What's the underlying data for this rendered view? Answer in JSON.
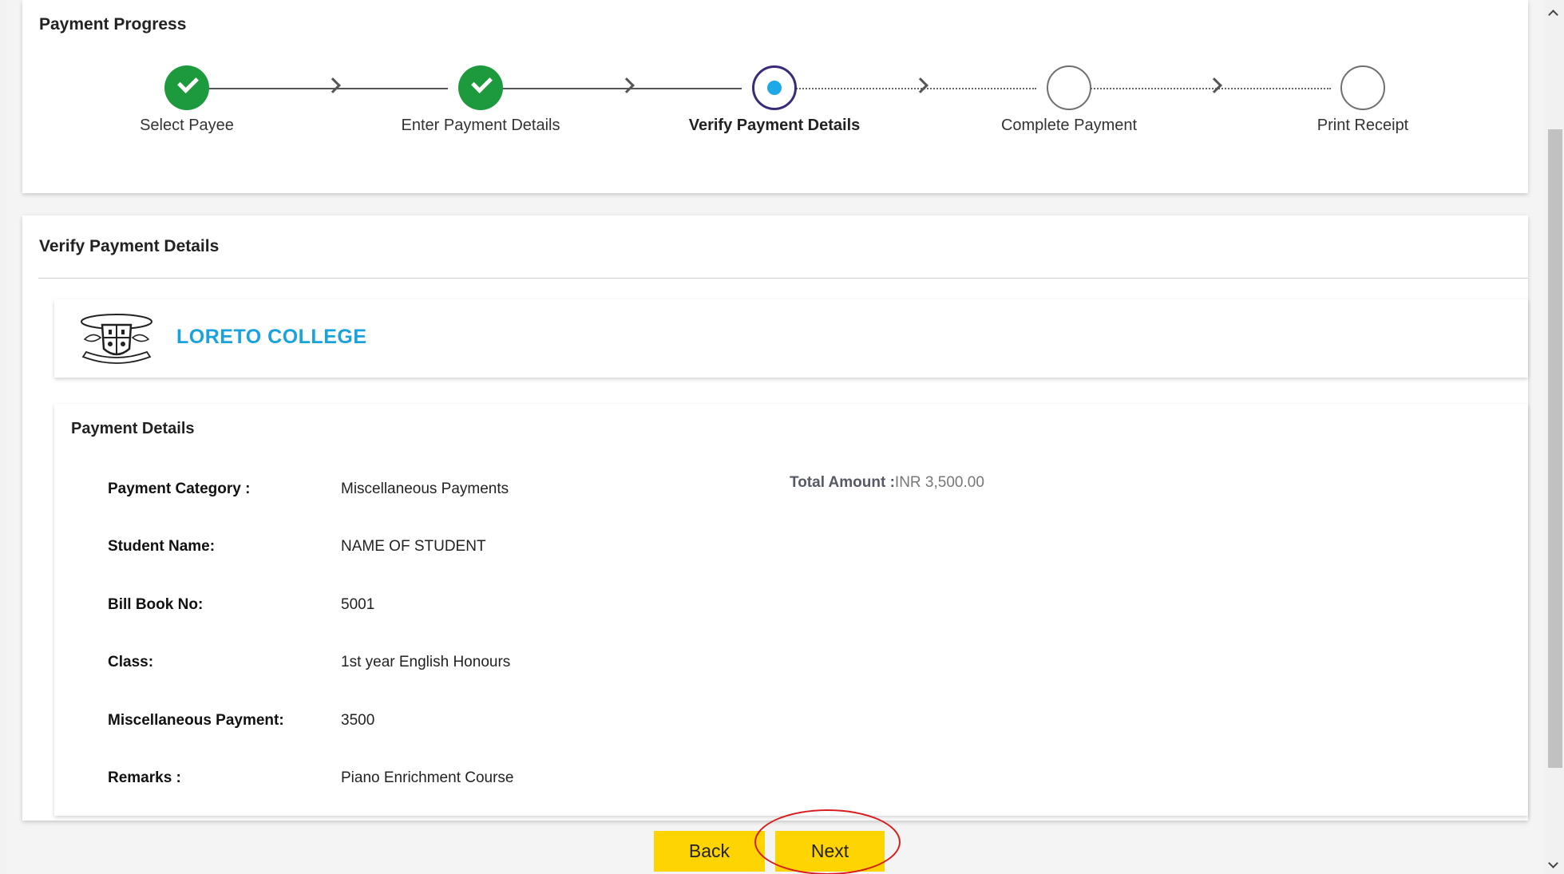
{
  "progress": {
    "title": "Payment Progress",
    "steps": [
      {
        "label": "Select Payee",
        "state": "done"
      },
      {
        "label": "Enter Payment Details",
        "state": "done"
      },
      {
        "label": "Verify Payment Details",
        "state": "current"
      },
      {
        "label": "Complete Payment",
        "state": "pending"
      },
      {
        "label": "Print Receipt",
        "state": "pending"
      }
    ]
  },
  "verify": {
    "title": "Verify Payment Details",
    "college": {
      "name": "LORETO COLLEGE",
      "logo_icon": "college-crest-logo"
    },
    "details": {
      "title": "Payment Details",
      "total_label": "Total Amount :",
      "total_value": "INR 3,500.00",
      "fields": [
        {
          "label": "Payment Category :",
          "value": "Miscellaneous Payments"
        },
        {
          "label": "Student Name:",
          "value": "NAME OF STUDENT"
        },
        {
          "label": "Bill Book No:",
          "value": "5001"
        },
        {
          "label": "Class:",
          "value": "1st year English Honours"
        },
        {
          "label": "Miscellaneous Payment:",
          "value": "3500"
        },
        {
          "label": "Remarks :",
          "value": "Piano Enrichment Course"
        }
      ]
    }
  },
  "actions": {
    "back_label": "Back",
    "next_label": "Next"
  },
  "colors": {
    "step_done": "#1e9a3e",
    "step_current_ring": "#3b2a7a",
    "step_current_dot": "#1ea8e6",
    "college_name": "#19a2de",
    "button": "#ffd400",
    "highlight": "#d81c1c"
  }
}
